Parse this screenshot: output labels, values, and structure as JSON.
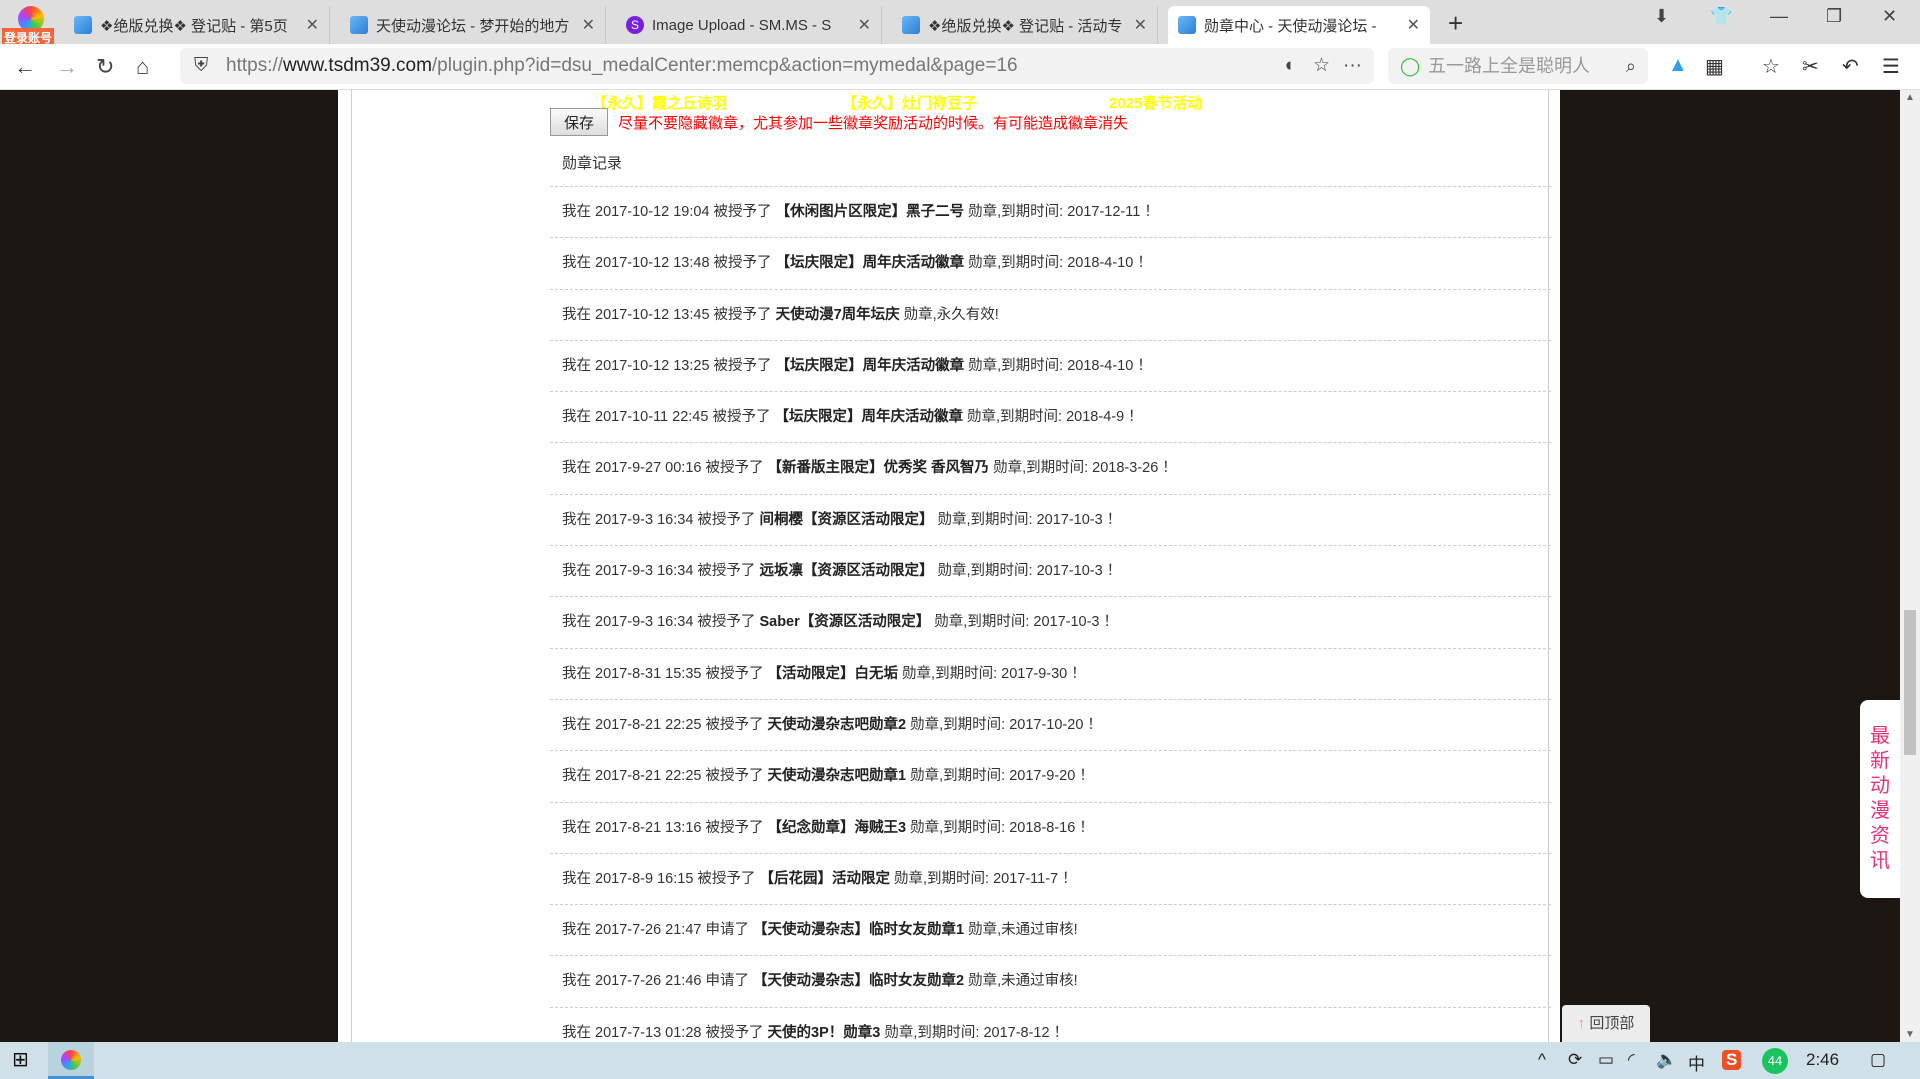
{
  "browser": {
    "login_label": "登录账号",
    "tabs": [
      {
        "title": "❖绝版兑换❖ 登记贴 - 第5页"
      },
      {
        "title": "天使动漫论坛 - 梦开始的地方"
      },
      {
        "title": "Image Upload - SM.MS - S"
      },
      {
        "title": "❖绝版兑换❖ 登记贴 - 活动专"
      },
      {
        "title": "勋章中心 - 天使动漫论坛 -"
      }
    ],
    "url_prefix": "https://",
    "url_domain": "www.tsdm39.com",
    "url_path": "/plugin.php?id=dsu_medalCenter:memcp&action=mymedal&page=16",
    "search_placeholder": "五一路上全是聪明人"
  },
  "page": {
    "medal_names": [
      "【永久】霞之丘诗羽",
      "【永久】灶门祢豆子",
      "2025春节活动"
    ],
    "save_label": "保存",
    "warning": "尽量不要隐藏徽章，尤其参加一些徽章奖励活动的时候。有可能造成徽章消失",
    "record_heading": "勋章记录",
    "records": [
      {
        "pre": "我在 2017-10-12 19:04 被授予了 ",
        "medal": "【休闲图片区限定】黑子二号",
        "post": " 勋章,到期时间: 2017-12-11 ！"
      },
      {
        "pre": "我在 2017-10-12 13:48 被授予了 ",
        "medal": "【坛庆限定】周年庆活动徽章",
        "post": " 勋章,到期时间: 2018-4-10 ！"
      },
      {
        "pre": "我在 2017-10-12 13:45 被授予了 ",
        "medal": "天使动漫7周年坛庆",
        "post": " 勋章,永久有效!"
      },
      {
        "pre": "我在 2017-10-12 13:25 被授予了 ",
        "medal": "【坛庆限定】周年庆活动徽章",
        "post": " 勋章,到期时间: 2018-4-10 ！"
      },
      {
        "pre": "我在 2017-10-11 22:45 被授予了 ",
        "medal": "【坛庆限定】周年庆活动徽章",
        "post": " 勋章,到期时间: 2018-4-9 ！"
      },
      {
        "pre": "我在 2017-9-27 00:16 被授予了 ",
        "medal": "【新番版主限定】优秀奖 香风智乃",
        "post": " 勋章,到期时间: 2018-3-26 ！"
      },
      {
        "pre": "我在 2017-9-3 16:34 被授予了 ",
        "medal": "间桐樱【资源区活动限定】",
        "post": " 勋章,到期时间: 2017-10-3 ！"
      },
      {
        "pre": "我在 2017-9-3 16:34 被授予了 ",
        "medal": "远坂凛【资源区活动限定】",
        "post": " 勋章,到期时间: 2017-10-3 ！"
      },
      {
        "pre": "我在 2017-9-3 16:34 被授予了 ",
        "medal": "Saber【资源区活动限定】",
        "post": " 勋章,到期时间: 2017-10-3 ！"
      },
      {
        "pre": "我在 2017-8-31 15:35 被授予了 ",
        "medal": "【活动限定】白无垢",
        "post": " 勋章,到期时间: 2017-9-30 ！"
      },
      {
        "pre": "我在 2017-8-21 22:25 被授予了 ",
        "medal": "天使动漫杂志吧勋章2",
        "post": " 勋章,到期时间: 2017-10-20 ！"
      },
      {
        "pre": "我在 2017-8-21 22:25 被授予了 ",
        "medal": "天使动漫杂志吧勋章1",
        "post": " 勋章,到期时间: 2017-9-20 ！"
      },
      {
        "pre": "我在 2017-8-21 13:16 被授予了 ",
        "medal": "【纪念勋章】海贼王3",
        "post": " 勋章,到期时间: 2018-8-16 ！"
      },
      {
        "pre": "我在 2017-8-9 16:15 被授予了 ",
        "medal": "【后花园】活动限定",
        "post": " 勋章,到期时间: 2017-11-7 ！"
      },
      {
        "pre": "我在 2017-7-26 21:47 申请了 ",
        "medal": "【天使动漫杂志】临时女友勋章1",
        "post": " 勋章,未通过审核!"
      },
      {
        "pre": "我在 2017-7-26 21:46 申请了 ",
        "medal": "【天使动漫杂志】临时女友勋章2",
        "post": " 勋章,未通过审核!"
      },
      {
        "pre": "我在 2017-7-13 01:28 被授予了 ",
        "medal": "天使的3P！勋章3",
        "post": " 勋章,到期时间: 2017-8-12 ！"
      }
    ],
    "side_panel": "最新动漫资讯",
    "back_to_top": "回顶部"
  },
  "taskbar": {
    "ime": "中",
    "badge": "44",
    "clock": "2:46"
  }
}
